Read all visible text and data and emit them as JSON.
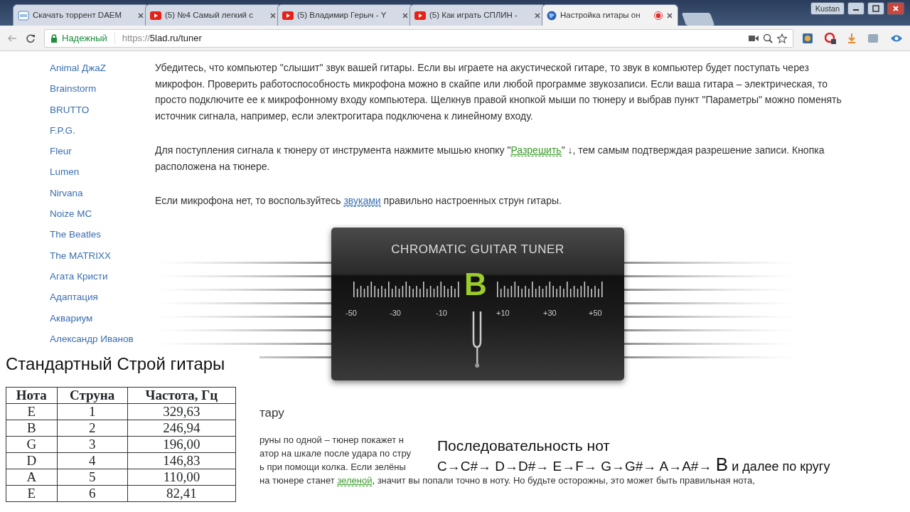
{
  "browser": {
    "tabs": [
      {
        "title": "Скачать торрент DAEM",
        "kind": "tile",
        "selected": false,
        "recording": false
      },
      {
        "title": "(5) №4 Самый легкий с",
        "kind": "video",
        "selected": false,
        "recording": false
      },
      {
        "title": "(5) Владимир Герыч - Y",
        "kind": "video",
        "selected": false,
        "recording": false
      },
      {
        "title": "(5) Как играть СПЛИН -",
        "kind": "video",
        "selected": false,
        "recording": false
      },
      {
        "title": "Настройка гитары он",
        "kind": "globe",
        "selected": true,
        "recording": true
      }
    ],
    "profile": "Kustan",
    "toolbar": {
      "security": "Надежный",
      "url_scheme": "https://",
      "url_rest": "5lad.ru/tuner"
    }
  },
  "sidebar": {
    "items": [
      "Animal ДжаZ",
      "Brainstorm",
      "BRUTTO",
      "F.P.G.",
      "Fleur",
      "Lumen",
      "Nirvana",
      "Noize MC",
      "The Beatles",
      "The MATRIXX",
      "Агата Кристи",
      "Адаптация",
      "Аквариум",
      "Александр Иванов"
    ]
  },
  "article": {
    "paragraphs": [
      [
        {
          "kind": "text",
          "text": "Убедитесь, что компьютер \"слышит\" звук вашей гитары. Если вы играете на акустической гитаре, то звук в компьютер будет поступать через микрофон. Проверить работоспособность микрофона можно в скайпе или любой программе звукозаписи. Если ваша гитара – электрическая, то просто подключите ее к микрофонному входу компьютера. Щелкнув правой кнопкой мыши по тюнеру и выбрав пункт \"Параметры\" можно поменять источник сигнала, например, если электрогитара подключена к линейному входу."
        }
      ],
      [
        {
          "kind": "text",
          "text": "Для поступления сигнала к тюнеру от инструмента нажмите мышью кнопку \""
        },
        {
          "kind": "action",
          "text": "Разрешить"
        },
        {
          "kind": "text",
          "text": "\" ↓, тем самым подтверждая разрешение записи. Кнопка расположена на тюнере."
        }
      ],
      [
        {
          "kind": "text",
          "text": "Если микрофона нет, то воспользуйтесь "
        },
        {
          "kind": "link",
          "text": "звуками"
        },
        {
          "kind": "text",
          "text": " правильно настроенных струн гитары."
        }
      ]
    ],
    "tuner": {
      "title": "CHROMATIC GUITAR TUNER",
      "note": "B",
      "scale": [
        "-50",
        "-30",
        "-10",
        "+10",
        "+30",
        "+50"
      ]
    },
    "heading": "тару",
    "lines": [
      [
        {
          "kind": "text",
          "text": "руны по одной – тюнер покажет н"
        }
      ],
      [
        {
          "kind": "text",
          "text": "атор на шкале после удара по стру"
        }
      ],
      [
        {
          "kind": "text",
          "text": "ь при помощи колка. Если зелёны"
        }
      ],
      [
        {
          "kind": "text",
          "text": "на тюнере станет "
        },
        {
          "kind": "action",
          "text": "зеленой"
        },
        {
          "kind": "text",
          "text": ", значит вы попали точно в ноту. Но будьте осторожны, это может быть правильная нота,"
        }
      ]
    ]
  },
  "tuning_table": {
    "title": "Стандартный Строй гитары",
    "columns": [
      "Нота",
      "Струна",
      "Частота, Гц"
    ],
    "rows": [
      [
        "E",
        "1",
        "329,63"
      ],
      [
        "B",
        "2",
        "246,94"
      ],
      [
        "G",
        "3",
        "196,00"
      ],
      [
        "D",
        "4",
        "146,83"
      ],
      [
        "A",
        "5",
        "110,00"
      ],
      [
        "E",
        "6",
        "82,41"
      ]
    ]
  },
  "note_sequence": {
    "title": "Последовательность нот",
    "sequence": "C→C#→ D→D#→ E→F→ G→G#→ A→A#→",
    "last_note": "B",
    "suffix": "и далее по кругу"
  }
}
